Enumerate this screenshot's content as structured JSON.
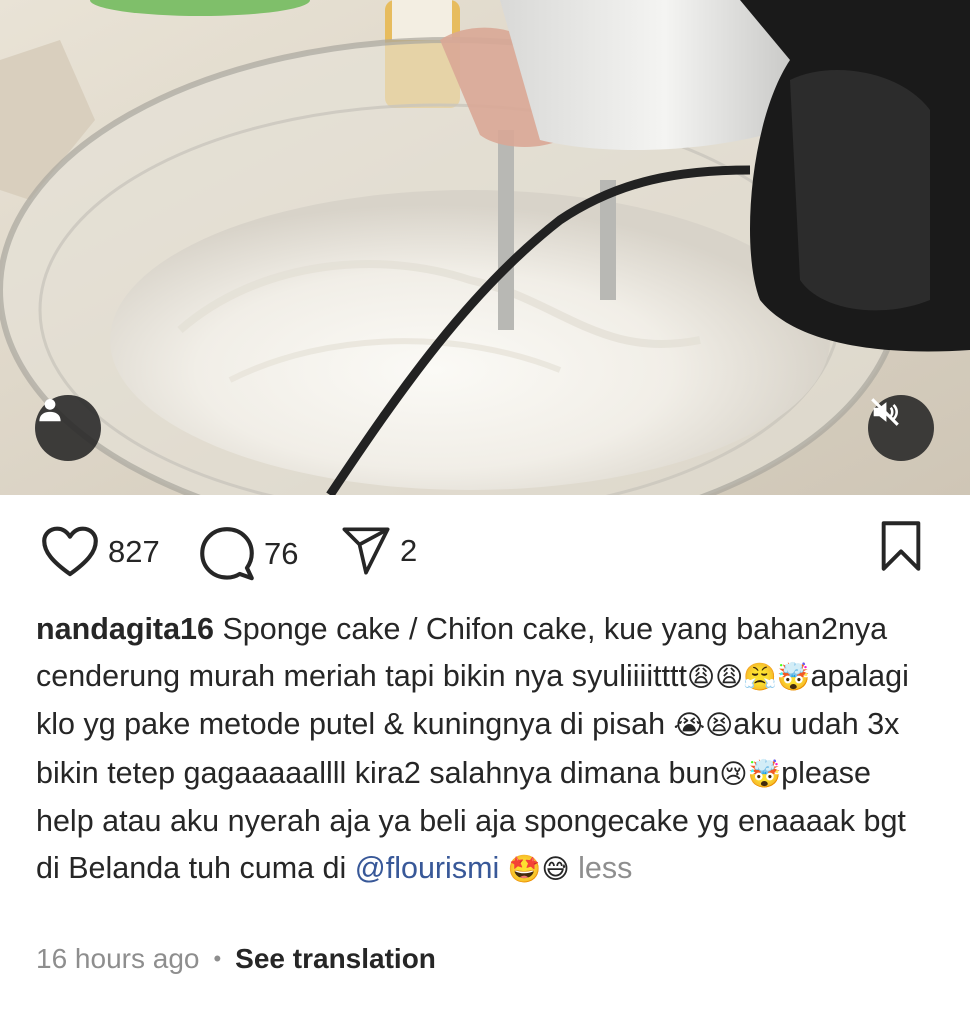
{
  "post": {
    "media": {
      "description_icon": "person-icon",
      "mute_icon": "speaker-muted-icon"
    },
    "actions": {
      "likes": "827",
      "comments": "76",
      "shares": "2",
      "like_icon": "heart-icon",
      "comment_icon": "comment-bubble-icon",
      "share_icon": "paper-plane-icon",
      "save_icon": "bookmark-icon"
    },
    "caption": {
      "username": "nandagita16",
      "text_1": " Sponge cake / Chifon cake, kue yang bahan2nya cenderung murah meriah tapi bikin nya syuliiiitttt",
      "emoji_1": "😩😩😤🤯",
      "text_2": "apalagi klo yg pake metode putel & kuningnya di pisah ",
      "emoji_2": "😭😫",
      "text_3": "aku udah 3x bikin tetep gagaaaaallll kira2 salahnya dimana bun",
      "emoji_3": "😢🤯",
      "text_4": "please help atau aku nyerah aja ya beli aja spongecake yg enaaaak bgt di Belanda tuh cuma di ",
      "mention": "@flourismi",
      "emoji_4": " 🤩😅",
      "less_label": " less"
    },
    "meta": {
      "time": "16 hours ago",
      "separator": "•",
      "translate_label": "See translation"
    },
    "colors": {
      "text": "#262626",
      "secondary": "#8e8e8e",
      "mention": "#385898"
    }
  }
}
